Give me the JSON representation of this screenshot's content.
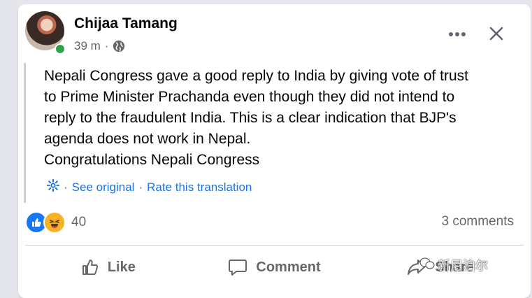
{
  "post": {
    "author": "Chijaa Tamang",
    "time": "39 m",
    "privacy_icon": "globe-icon",
    "text_lines": [
      "Nepali Congress gave a good reply to India by giving vote of trust",
      "to Prime Minister Prachanda even though they did not intend to",
      "reply to the fraudulent India. This is a clear indication that BJP's",
      "agenda does not work in Nepal.",
      "Congratulations Nepali Congress"
    ],
    "translation": {
      "sep1": "·",
      "see_original": "See original",
      "sep2": "·",
      "rate": "Rate this translation"
    }
  },
  "reactions": {
    "icons": [
      "like-icon",
      "haha-icon"
    ],
    "count": "40",
    "comments": "3 comments"
  },
  "actions": {
    "like": "Like",
    "comment": "Comment",
    "share": "Share"
  },
  "watermark": "新尼泊尔",
  "colors": {
    "link": "#1b74e4",
    "secondary_text": "#65676b",
    "online": "#31a24c",
    "like_blue": "#1877f2",
    "haha_yellow": "#f7b125"
  }
}
